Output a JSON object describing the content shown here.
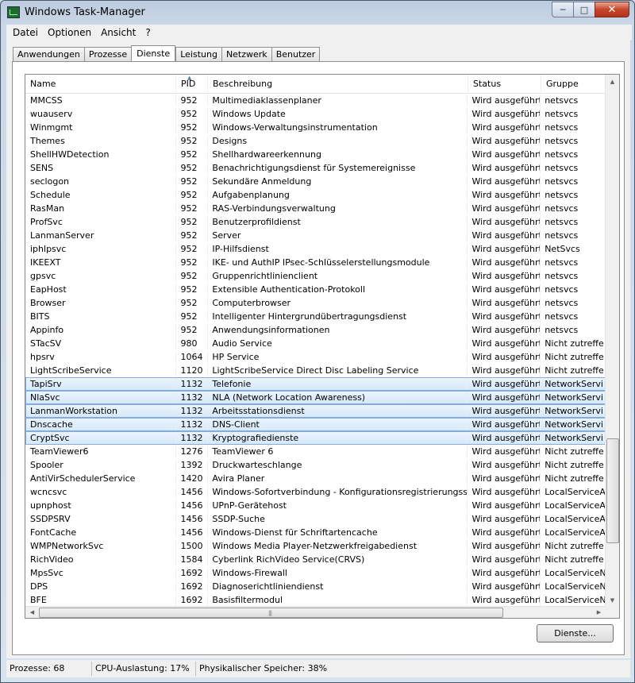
{
  "window": {
    "title": "Windows Task-Manager"
  },
  "menu": [
    "Datei",
    "Optionen",
    "Ansicht",
    "?"
  ],
  "tabs": [
    "Anwendungen",
    "Prozesse",
    "Dienste",
    "Leistung",
    "Netzwerk",
    "Benutzer"
  ],
  "active_tab": "Dienste",
  "columns": {
    "name": "Name",
    "pid": "PID",
    "description": "Beschreibung",
    "status": "Status",
    "group": "Gruppe"
  },
  "rows": [
    [
      "MMCSS",
      "952",
      "Multimediaklassenplaner",
      "Wird ausgeführt",
      "netsvcs"
    ],
    [
      "wuauserv",
      "952",
      "Windows Update",
      "Wird ausgeführt",
      "netsvcs"
    ],
    [
      "Winmgmt",
      "952",
      "Windows-Verwaltungsinstrumentation",
      "Wird ausgeführt",
      "netsvcs"
    ],
    [
      "Themes",
      "952",
      "Designs",
      "Wird ausgeführt",
      "netsvcs"
    ],
    [
      "ShellHWDetection",
      "952",
      "Shellhardwareerkennung",
      "Wird ausgeführt",
      "netsvcs"
    ],
    [
      "SENS",
      "952",
      "Benachrichtigungsdienst für Systemereignisse",
      "Wird ausgeführt",
      "netsvcs"
    ],
    [
      "seclogon",
      "952",
      "Sekundäre Anmeldung",
      "Wird ausgeführt",
      "netsvcs"
    ],
    [
      "Schedule",
      "952",
      "Aufgabenplanung",
      "Wird ausgeführt",
      "netsvcs"
    ],
    [
      "RasMan",
      "952",
      "RAS-Verbindungsverwaltung",
      "Wird ausgeführt",
      "netsvcs"
    ],
    [
      "ProfSvc",
      "952",
      "Benutzerprofildienst",
      "Wird ausgeführt",
      "netsvcs"
    ],
    [
      "LanmanServer",
      "952",
      "Server",
      "Wird ausgeführt",
      "netsvcs"
    ],
    [
      "iphlpsvc",
      "952",
      "IP-Hilfsdienst",
      "Wird ausgeführt",
      "NetSvcs"
    ],
    [
      "IKEEXT",
      "952",
      "IKE- und AuthIP IPsec-Schlüsselerstellungsmodule",
      "Wird ausgeführt",
      "netsvcs"
    ],
    [
      "gpsvc",
      "952",
      "Gruppenrichtlinienclient",
      "Wird ausgeführt",
      "netsvcs"
    ],
    [
      "EapHost",
      "952",
      "Extensible Authentication-Protokoll",
      "Wird ausgeführt",
      "netsvcs"
    ],
    [
      "Browser",
      "952",
      "Computerbrowser",
      "Wird ausgeführt",
      "netsvcs"
    ],
    [
      "BITS",
      "952",
      "Intelligenter Hintergrundübertragungsdienst",
      "Wird ausgeführt",
      "netsvcs"
    ],
    [
      "Appinfo",
      "952",
      "Anwendungsinformationen",
      "Wird ausgeführt",
      "netsvcs"
    ],
    [
      "STacSV",
      "980",
      "Audio Service",
      "Wird ausgeführt",
      "Nicht zutreffe"
    ],
    [
      "hpsrv",
      "1064",
      "HP Service",
      "Wird ausgeführt",
      "Nicht zutreffe"
    ],
    [
      "LightScribeService",
      "1120",
      "LightScribeService Direct Disc Labeling Service",
      "Wird ausgeführt",
      "Nicht zutreffe"
    ],
    [
      "TapiSrv",
      "1132",
      "Telefonie",
      "Wird ausgeführt",
      "NetworkServi"
    ],
    [
      "NlaSvc",
      "1132",
      "NLA (Network Location Awareness)",
      "Wird ausgeführt",
      "NetworkServi"
    ],
    [
      "LanmanWorkstation",
      "1132",
      "Arbeitsstationsdienst",
      "Wird ausgeführt",
      "NetworkServi"
    ],
    [
      "Dnscache",
      "1132",
      "DNS-Client",
      "Wird ausgeführt",
      "NetworkServi"
    ],
    [
      "CryptSvc",
      "1132",
      "Kryptografiedienste",
      "Wird ausgeführt",
      "NetworkServi"
    ],
    [
      "TeamViewer6",
      "1276",
      "TeamViewer 6",
      "Wird ausgeführt",
      "Nicht zutreffe"
    ],
    [
      "Spooler",
      "1392",
      "Druckwarteschlange",
      "Wird ausgeführt",
      "Nicht zutreffe"
    ],
    [
      "AntiVirSchedulerService",
      "1420",
      "Avira Planer",
      "Wird ausgeführt",
      "Nicht zutreffe"
    ],
    [
      "wcncsvc",
      "1456",
      "Windows-Sofortverbindung - Konfigurationsregistrierungsstelle",
      "Wird ausgeführt",
      "LocalServiceA"
    ],
    [
      "upnphost",
      "1456",
      "UPnP-Gerätehost",
      "Wird ausgeführt",
      "LocalServiceA"
    ],
    [
      "SSDPSRV",
      "1456",
      "SSDP-Suche",
      "Wird ausgeführt",
      "LocalServiceA"
    ],
    [
      "FontCache",
      "1456",
      "Windows-Dienst für Schriftartencache",
      "Wird ausgeführt",
      "LocalServiceA"
    ],
    [
      "WMPNetworkSvc",
      "1500",
      "Windows Media Player-Netzwerkfreigabedienst",
      "Wird ausgeführt",
      "Nicht zutreffe"
    ],
    [
      "RichVideo",
      "1584",
      "Cyberlink RichVideo Service(CRVS)",
      "Wird ausgeführt",
      "Nicht zutreffe"
    ],
    [
      "MpsSvc",
      "1692",
      "Windows-Firewall",
      "Wird ausgeführt",
      "LocalServiceN"
    ],
    [
      "DPS",
      "1692",
      "Diagnoserichtliniendienst",
      "Wird ausgeführt",
      "LocalServiceN"
    ],
    [
      "BFE",
      "1692",
      "Basisfiltermodul",
      "Wird ausgeführt",
      "LocalServiceN"
    ]
  ],
  "selected_rows": [
    21,
    22,
    23,
    24,
    25
  ],
  "buttons": {
    "services": "Dienste..."
  },
  "status": {
    "processes": "Prozesse: 68",
    "cpu": "CPU-Auslastung: 17%",
    "memory": "Physikalischer Speicher: 38%"
  },
  "icons": {
    "app": "taskmanager-icon",
    "minimize": "minimize-icon",
    "maximize": "maximize-icon",
    "close": "close-icon",
    "sort": "sort-ascending-icon"
  }
}
